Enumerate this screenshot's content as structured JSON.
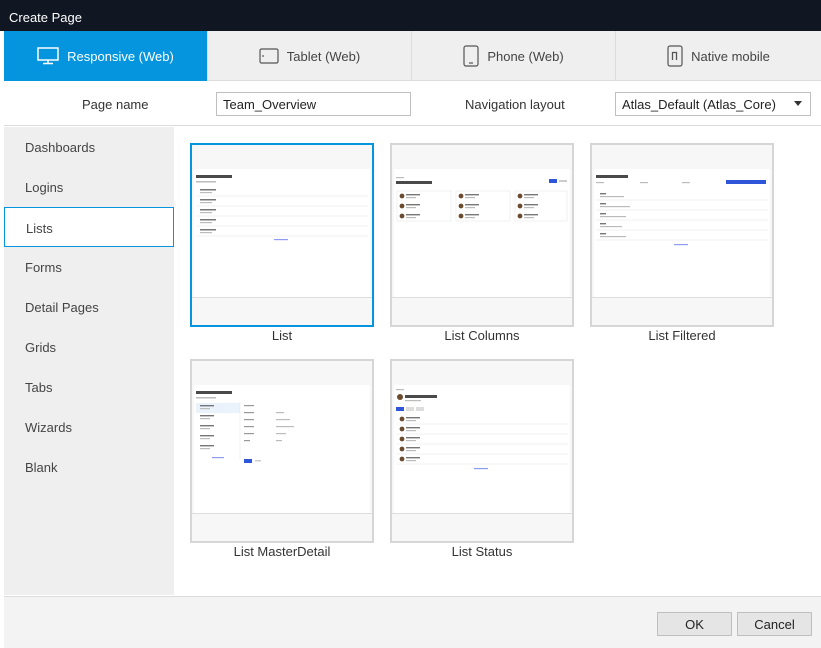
{
  "window": {
    "title": "Create Page"
  },
  "tabs": [
    {
      "label": "Responsive (Web)",
      "icon": "monitor-icon",
      "active": true
    },
    {
      "label": "Tablet (Web)",
      "icon": "tablet-icon",
      "active": false
    },
    {
      "label": "Phone (Web)",
      "icon": "phone-icon",
      "active": false
    },
    {
      "label": "Native mobile",
      "icon": "native-mobile-icon",
      "active": false
    }
  ],
  "form": {
    "page_name_label": "Page name",
    "page_name_value": "Team_Overview",
    "navigation_label": "Navigation layout",
    "navigation_value": "Atlas_Default (Atlas_Core)"
  },
  "sidebar": {
    "items": [
      {
        "label": "Dashboards"
      },
      {
        "label": "Logins"
      },
      {
        "label": "Lists"
      },
      {
        "label": "Forms"
      },
      {
        "label": "Detail Pages"
      },
      {
        "label": "Grids"
      },
      {
        "label": "Tabs"
      },
      {
        "label": "Wizards"
      },
      {
        "label": "Blank"
      }
    ],
    "active": "Lists"
  },
  "templates": [
    {
      "label": "List",
      "selected": true
    },
    {
      "label": "List Columns",
      "selected": false
    },
    {
      "label": "List Filtered",
      "selected": false
    },
    {
      "label": "List MasterDetail",
      "selected": false
    },
    {
      "label": "List Status",
      "selected": false
    }
  ],
  "footer": {
    "ok_label": "OK",
    "cancel_label": "Cancel"
  },
  "colors": {
    "accent": "#0595de",
    "titlebar": "#111722",
    "sidebar_bg": "#efefef"
  }
}
